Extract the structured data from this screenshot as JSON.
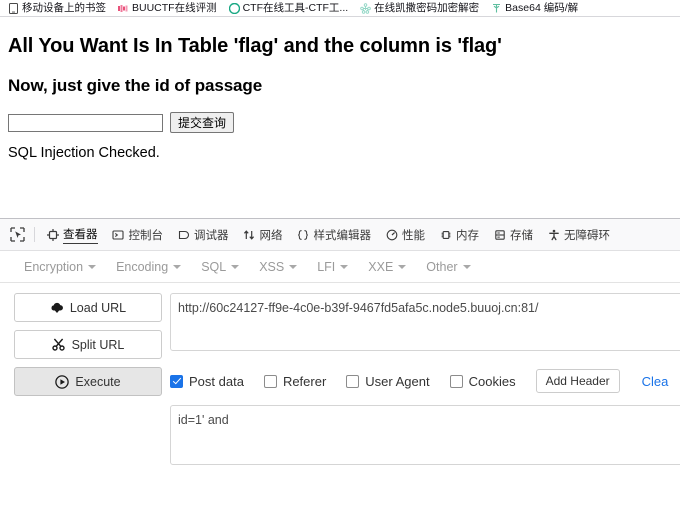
{
  "bookmarks": [
    {
      "label": "移动设备上的书签",
      "icon": "mobile-device-icon",
      "color": "#4a4a4a"
    },
    {
      "label": "BUUCTF在线评测",
      "icon": "buuctf-favicon",
      "color": "#e8527a"
    },
    {
      "label": "CTF在线工具-CTF工...",
      "icon": "ctf-tools-favicon",
      "color": "#1aa884"
    },
    {
      "label": "在线凯撒密码加密解密",
      "icon": "caesar-cipher-favicon",
      "color": "#8fd6c4"
    },
    {
      "label": "Base64 编码/解",
      "icon": "base64-favicon",
      "color": "#5fbfa0"
    }
  ],
  "page": {
    "heading1": "All You Want Is In Table 'flag' and the column is 'flag'",
    "heading2": "Now, just give the id of passage",
    "query_input_value": "",
    "query_input_placeholder": "",
    "submit_label": "提交查询",
    "status_message": "SQL Injection Checked."
  },
  "devtools": {
    "picker_icon": "element-picker-icon",
    "tabs": [
      {
        "label": "查看器",
        "icon": "inspector-icon",
        "active": true
      },
      {
        "label": "控制台",
        "icon": "console-icon",
        "active": false
      },
      {
        "label": "调试器",
        "icon": "debugger-icon",
        "active": false
      },
      {
        "label": "网络",
        "icon": "network-icon",
        "active": false
      },
      {
        "label": "样式编辑器",
        "icon": "style-editor-icon",
        "active": false
      },
      {
        "label": "性能",
        "icon": "performance-icon",
        "active": false
      },
      {
        "label": "内存",
        "icon": "memory-icon",
        "active": false
      },
      {
        "label": "存储",
        "icon": "storage-icon",
        "active": false
      },
      {
        "label": "无障碍环",
        "icon": "accessibility-icon",
        "active": false
      }
    ]
  },
  "hackbar": {
    "menus": [
      {
        "label": "Encryption"
      },
      {
        "label": "Encoding"
      },
      {
        "label": "SQL"
      },
      {
        "label": "XSS"
      },
      {
        "label": "LFI"
      },
      {
        "label": "XXE"
      },
      {
        "label": "Other"
      }
    ],
    "buttons": [
      {
        "label": "Load URL",
        "icon": "cloud-download-icon",
        "pressed": false
      },
      {
        "label": "Split URL",
        "icon": "scissors-icon",
        "pressed": false
      },
      {
        "label": "Execute",
        "icon": "play-circle-icon",
        "pressed": true
      }
    ],
    "url_value": "http://60c24127-ff9e-4c0e-b39f-9467fd5afa5c.node5.buuoj.cn:81/",
    "url_placeholder": "",
    "checkboxes": [
      {
        "label": "Post data",
        "checked": true
      },
      {
        "label": "Referer",
        "checked": false
      },
      {
        "label": "User Agent",
        "checked": false
      },
      {
        "label": "Cookies",
        "checked": false
      }
    ],
    "add_header_label": "Add Header",
    "clear_label": "Clea",
    "post_data_value": "id=1' and",
    "post_data_placeholder": "",
    "accent_color": "#1a73e8"
  }
}
